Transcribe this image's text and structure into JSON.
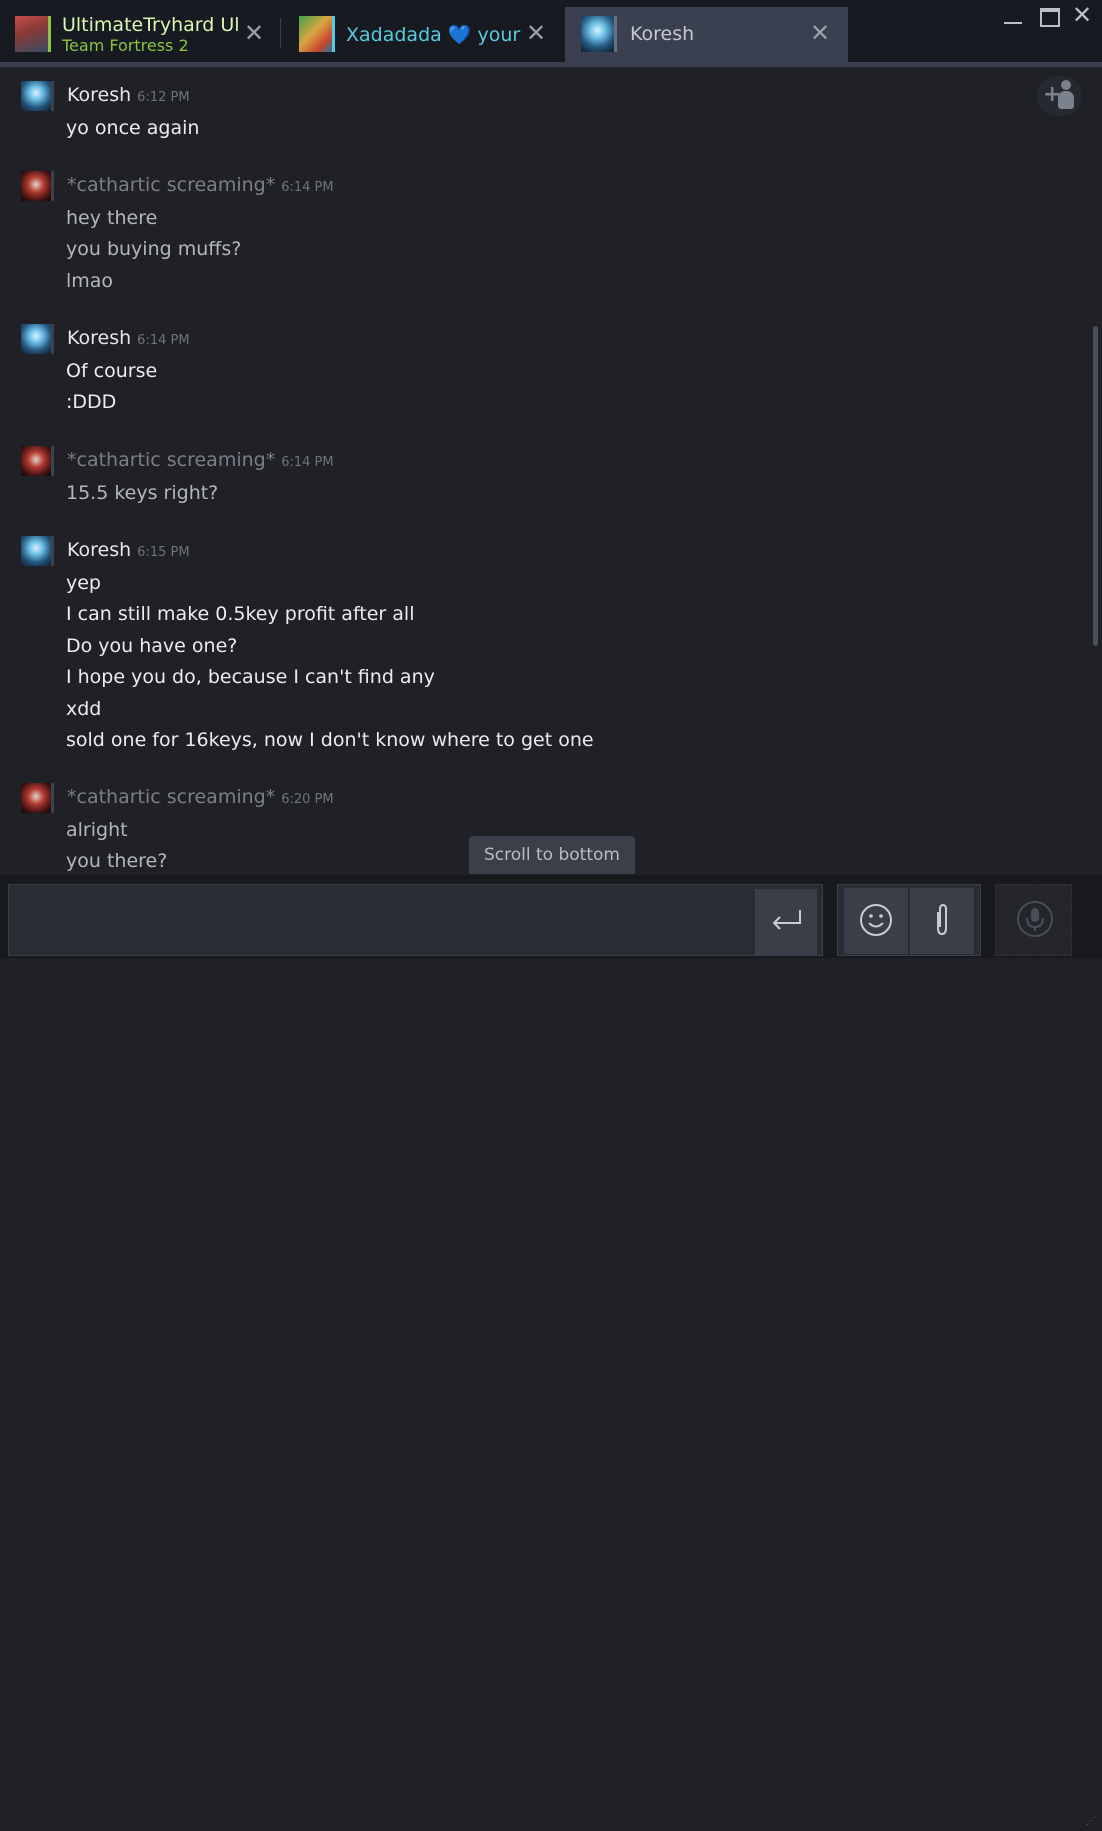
{
  "tabs": [
    {
      "name": "UltimateTryhard Ul",
      "subtitle": "Team Fortress 2",
      "close": "✕"
    },
    {
      "name": "Xadadada 💙 your",
      "close": "✕"
    },
    {
      "name": "Koresh",
      "close": "✕"
    }
  ],
  "window": {
    "minimize": "—",
    "maximize": "☐",
    "close": "✕"
  },
  "messages": [
    {
      "sender": "Koresh",
      "time": "6:12 PM",
      "lines": [
        "yo once again"
      ]
    },
    {
      "sender": "*cathartic screaming*",
      "time": "6:14 PM",
      "lines": [
        "hey there",
        "you buying muffs?",
        "lmao"
      ]
    },
    {
      "sender": "Koresh",
      "time": "6:14 PM",
      "lines": [
        "Of course",
        ":DDD"
      ]
    },
    {
      "sender": "*cathartic screaming*",
      "time": "6:14 PM",
      "lines": [
        "15.5 keys right?"
      ]
    },
    {
      "sender": "Koresh",
      "time": "6:15 PM",
      "lines": [
        "yep",
        "I can still make 0.5key profit after all",
        "Do you have one?",
        "I hope you do, because I can't find any",
        "xdd",
        "sold one for 16keys, now I don't know where to get one"
      ]
    },
    {
      "sender": "*cathartic screaming*",
      "time": "6:20 PM",
      "lines": [
        "alright",
        "you there?"
      ]
    }
  ],
  "scroll_to_bottom": "Scroll to bottom",
  "input": {
    "value": "",
    "placeholder": ""
  },
  "icons": {
    "add_friend": "add-friend-icon",
    "send": "enter-arrow-icon",
    "emoji": "smiley-icon",
    "attach": "paperclip-icon",
    "voice": "microphone-icon"
  },
  "colors": {
    "background": "#1f2126",
    "tabbar": "#171a21",
    "active_tab": "#3a4050",
    "in_game_green": "#8bc53f",
    "online_blue": "#57cbde"
  }
}
